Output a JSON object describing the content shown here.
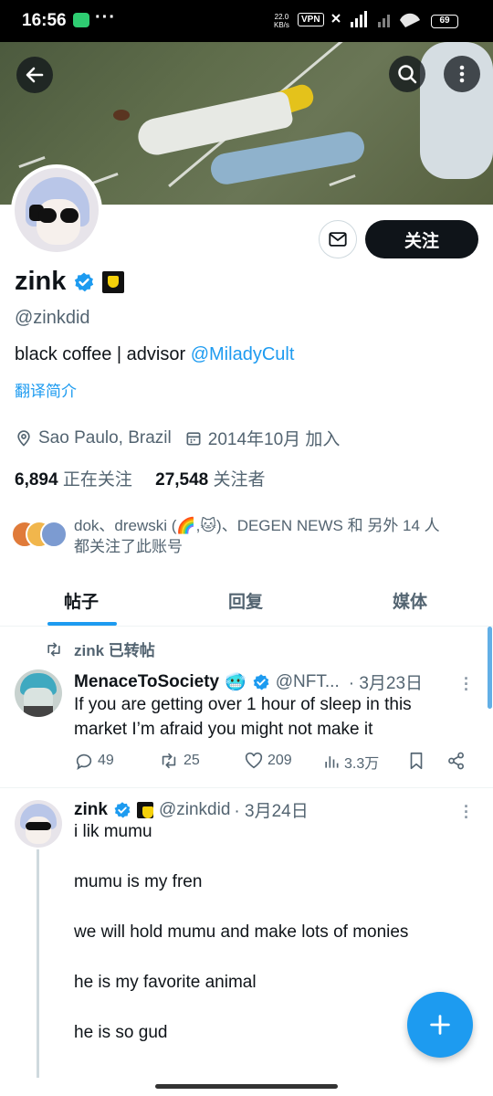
{
  "status_bar": {
    "time": "16:56",
    "dots": "···",
    "speed_top": "22.0",
    "speed_bottom": "KB/s",
    "vpn": "VPN",
    "battery": "69"
  },
  "profile": {
    "name": "zink",
    "handle": "@zinkdid",
    "bio_text": "black coffee | advisor ",
    "bio_link": "@MiladyCult",
    "translate": "翻译简介",
    "location": "Sao Paulo, Brazil",
    "joined": "2014年10月 加入",
    "following_count": "6,894",
    "following_label": "正在关注",
    "followers_count": "27,548",
    "followers_label": "关注者",
    "followed_by_line1": "dok、drewski (🌈,🐱)、DEGEN NEWS 和 另外 14 人",
    "followed_by_line2": "都关注了此账号",
    "follow_button": "关注"
  },
  "tabs": [
    "帖子",
    "回复",
    "媒体"
  ],
  "retweet_label": "zink 已转帖",
  "tweets": [
    {
      "name": "MenaceToSociety",
      "emoji": "🥶",
      "handle": "@NFT...",
      "date": "· 3月23日",
      "text_line1": "If you are getting over 1 hour of sleep in this",
      "text_line2": "market I’m afraid you might not make it",
      "replies": "49",
      "retweets": "25",
      "likes": "209",
      "views": "3.3万"
    },
    {
      "name": "zink",
      "handle": "@zinkdid",
      "date": "· 3月24日",
      "paragraphs": [
        "i lik mumu",
        "mumu is my fren",
        "we will hold mumu and make lots of monies",
        "he is my favorite animal",
        "he is so gud"
      ]
    }
  ],
  "colors": {
    "accent": "#1d9bf0",
    "text": "#0f1419",
    "muted": "#536471",
    "follow_bg": "#0f1419"
  },
  "icons": [
    "back-arrow-icon",
    "search-icon",
    "more-vertical-icon",
    "mail-icon",
    "verified-icon",
    "location-icon",
    "calendar-icon",
    "retweet-icon",
    "reply-icon",
    "like-icon",
    "views-icon",
    "bookmark-icon",
    "share-icon",
    "plus-icon"
  ]
}
